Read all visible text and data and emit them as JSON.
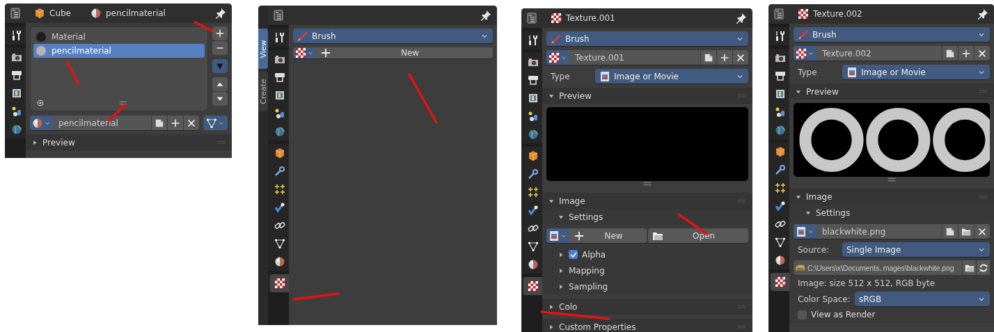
{
  "panels": [
    {
      "header": [
        {
          "kind": "object",
          "text": "Cube"
        },
        {
          "kind": "material",
          "text": "pencilmaterial"
        }
      ],
      "tab_groups": [
        [
          {
            "selected": false
          }
        ],
        [
          {
            "selected": false
          },
          {
            "selected": false
          },
          {
            "selected": false
          },
          {
            "selected": false
          },
          {
            "selected": false
          }
        ]
      ],
      "rows": [
        {
          "kind": "material_list",
          "items": [
            {
              "name": "Material",
              "selected": false,
              "color": "#1e1e1e"
            },
            {
              "name": "pencilmaterial",
              "selected": true,
              "color": "#b4b4b4"
            }
          ]
        },
        {
          "kind": "material_field",
          "value": "pencilmaterial"
        },
        {
          "kind": "section",
          "label": "Preview",
          "expanded": false
        }
      ]
    },
    {
      "side_tabs": [
        {
          "label": "View",
          "selected": true
        },
        {
          "label": "Create",
          "selected": false
        }
      ],
      "tab_groups": [
        [
          {
            "selected": false
          }
        ],
        [
          {
            "selected": false
          },
          {
            "selected": false
          },
          {
            "selected": false
          },
          {
            "selected": false
          },
          {
            "selected": false
          }
        ],
        [
          {
            "selected": false
          },
          {
            "selected": false
          },
          {
            "selected": false
          },
          {
            "selected": false
          },
          {
            "selected": false
          },
          {
            "selected": false
          },
          {
            "selected": false
          }
        ],
        [
          {
            "selected": true
          }
        ]
      ],
      "rows": [
        {
          "kind": "brush_dropdown",
          "value": "Brush"
        },
        {
          "kind": "new_button",
          "label": "New"
        }
      ]
    },
    {
      "header": [
        {
          "kind": "texture",
          "text": "Texture.001"
        }
      ],
      "tab_groups": [
        [
          {
            "selected": false
          }
        ],
        [
          {
            "selected": false
          },
          {
            "selected": false
          },
          {
            "selected": false
          },
          {
            "selected": false
          },
          {
            "selected": false
          }
        ],
        [
          {
            "selected": false
          },
          {
            "selected": false
          },
          {
            "selected": false
          },
          {
            "selected": false
          },
          {
            "selected": false
          },
          {
            "selected": false
          },
          {
            "selected": false
          }
        ],
        [
          {
            "selected": true
          }
        ]
      ],
      "rows": [
        {
          "kind": "brush_dropdown",
          "value": "Brush"
        },
        {
          "kind": "texture_field",
          "value": "Texture.001"
        },
        {
          "kind": "type_dropdown",
          "label": "Type",
          "value": "Image or Movie"
        },
        {
          "kind": "section",
          "label": "Preview",
          "expanded": true,
          "children": [
            {
              "kind": "empty_preview"
            }
          ]
        },
        {
          "kind": "section",
          "label": "Image",
          "expanded": true,
          "children": [
            {
              "kind": "section",
              "label": "Settings",
              "expanded": true,
              "children": [
                {
                  "kind": "new_open",
                  "new": "New",
                  "open": "Open"
                }
              ]
            },
            {
              "kind": "section",
              "label": "Alpha",
              "expanded": false,
              "checked": true
            },
            {
              "kind": "section",
              "label": "Mapping",
              "expanded": false
            },
            {
              "kind": "section",
              "label": "Sampling",
              "expanded": false
            }
          ]
        },
        {
          "kind": "section",
          "label": "Colo",
          "expanded": false
        },
        {
          "kind": "section",
          "label": "Custom Properties",
          "expanded": false
        }
      ]
    },
    {
      "header": [
        {
          "kind": "texture",
          "text": "Texture.002"
        }
      ],
      "tab_groups": [
        [
          {
            "selected": false
          }
        ],
        [
          {
            "selected": false
          },
          {
            "selected": false
          },
          {
            "selected": false
          },
          {
            "selected": false
          },
          {
            "selected": false
          }
        ],
        [
          {
            "selected": false
          },
          {
            "selected": false
          },
          {
            "selected": false
          },
          {
            "selected": false
          },
          {
            "selected": false
          },
          {
            "selected": false
          },
          {
            "selected": false
          }
        ],
        [
          {
            "selected": true
          }
        ]
      ],
      "rows": [
        {
          "kind": "brush_dropdown",
          "value": "Brush"
        },
        {
          "kind": "texture_field",
          "value": "Texture.002"
        },
        {
          "kind": "type_dropdown",
          "label": "Type",
          "value": "Image or Movie"
        },
        {
          "kind": "section",
          "label": "Preview",
          "expanded": true,
          "children": [
            {
              "kind": "rings_preview"
            }
          ]
        },
        {
          "kind": "section",
          "label": "Image",
          "expanded": true,
          "children": [
            {
              "kind": "section",
              "label": "Settings",
              "expanded": true,
              "children": [
                {
                  "kind": "image_field",
                  "value": "blackwhite.png"
                },
                {
                  "kind": "property",
                  "label": "Source:",
                  "value": "Single Image"
                },
                {
                  "kind": "path_field",
                  "value": "C:\\Users\\x\\Documents..mages\\blackwhite.png"
                },
                {
                  "kind": "text",
                  "text": "Image: size 512 x 512, RGB byte"
                },
                {
                  "kind": "property",
                  "label": "Color Space:",
                  "value": "sRGB"
                },
                {
                  "kind": "checkbox",
                  "label": "View as Render",
                  "checked": false
                }
              ]
            }
          ]
        }
      ]
    }
  ]
}
